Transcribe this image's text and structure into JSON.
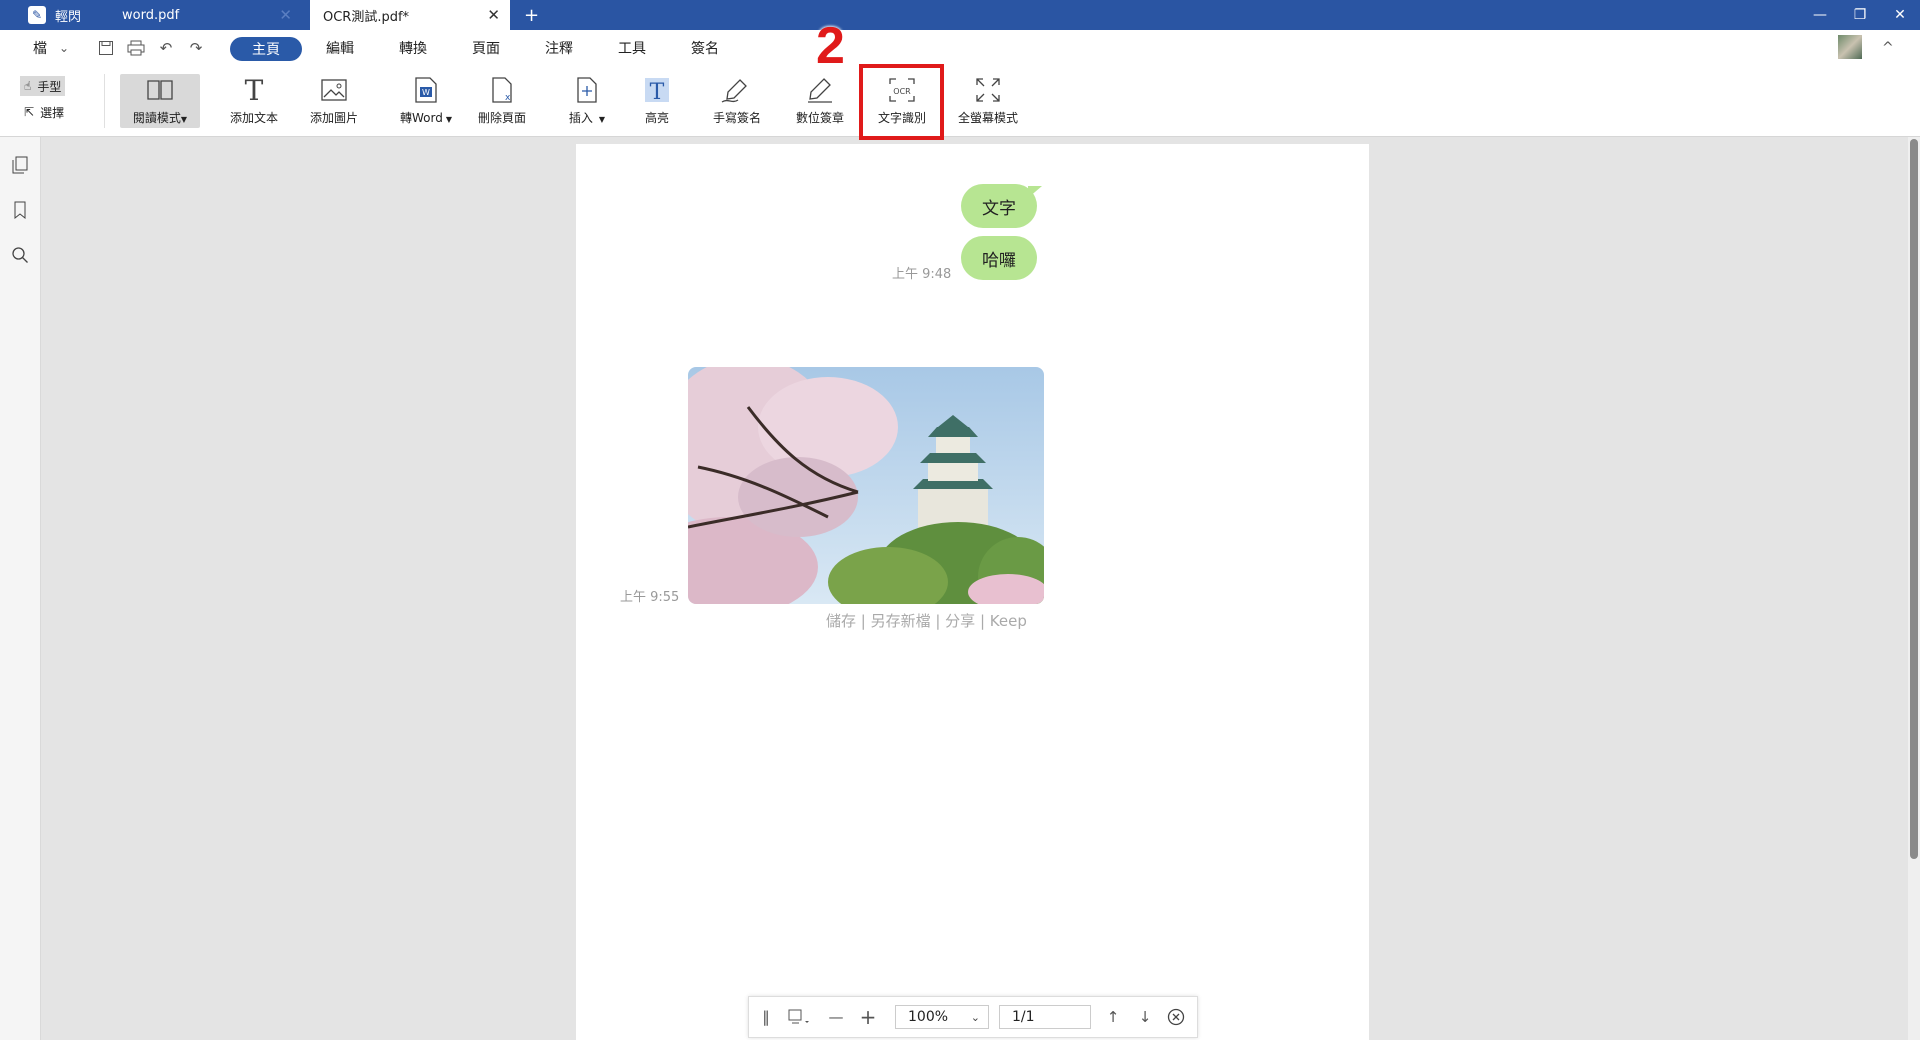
{
  "tabs": {
    "app_name": "輕閃",
    "file1": "word.pdf",
    "file2": "OCR測試.pdf*",
    "add": "+"
  },
  "window": {
    "minimize": "—",
    "restore": "❐",
    "close": "✕"
  },
  "menu": {
    "file": "檔",
    "file_arrow": "⌄",
    "home": "主頁",
    "edit": "編輯",
    "convert": "轉換",
    "page": "頁面",
    "annotate": "注釋",
    "tools": "工具",
    "sign": "簽名",
    "collapse": "^"
  },
  "modes": {
    "hand": "手型",
    "select": "選擇"
  },
  "toolbar": {
    "reading_mode": "閱讀模式",
    "add_text": "添加文本",
    "add_image": "添加圖片",
    "to_word": "轉Word",
    "delete_page": "刪除頁面",
    "insert": "插入",
    "highlight": "高亮",
    "handwrite_sign": "手寫簽名",
    "digital_stamp": "數位簽章",
    "ocr": "文字識別",
    "fullscreen": "全螢幕模式",
    "ocr_icon_text": "OCR"
  },
  "annotation": {
    "step": "2"
  },
  "document": {
    "bubble1": "文字",
    "bubble2": "哈囉",
    "time1": "上午 9:48",
    "time2": "上午 9:55",
    "photo_actions": "儲存 | 另存新檔 | 分享 | Keep"
  },
  "bottom": {
    "zoom": "100%",
    "page": "1/1"
  }
}
